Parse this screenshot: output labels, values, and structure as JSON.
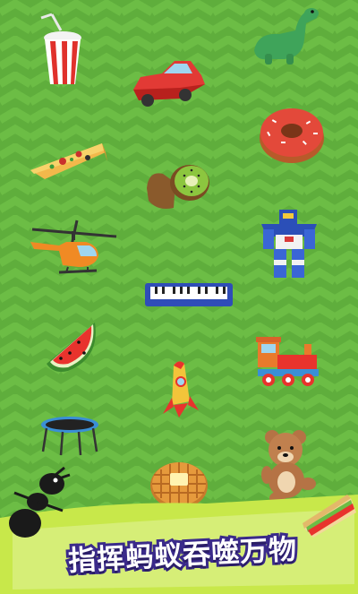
{
  "banner": {
    "caption": "指挥蚂蚁吞噬万物"
  },
  "colors": {
    "background": "#5fae3c",
    "chevron": "#6cbd45",
    "banner_fill": "#c8e84a",
    "text_stroke": "#3a2a8a"
  },
  "items": [
    {
      "name": "soda-cup-icon"
    },
    {
      "name": "toy-car-icon"
    },
    {
      "name": "dinosaur-icon"
    },
    {
      "name": "pizza-slice-icon"
    },
    {
      "name": "donut-icon"
    },
    {
      "name": "kiwi-fruit-icon"
    },
    {
      "name": "helicopter-icon"
    },
    {
      "name": "robot-toy-icon"
    },
    {
      "name": "keyboard-piano-icon"
    },
    {
      "name": "watermelon-slice-icon"
    },
    {
      "name": "rocket-icon"
    },
    {
      "name": "toy-train-icon"
    },
    {
      "name": "trampoline-icon"
    },
    {
      "name": "waffle-icon"
    },
    {
      "name": "teddy-bear-icon"
    },
    {
      "name": "ant-icon"
    },
    {
      "name": "sandwich-icon"
    }
  ]
}
